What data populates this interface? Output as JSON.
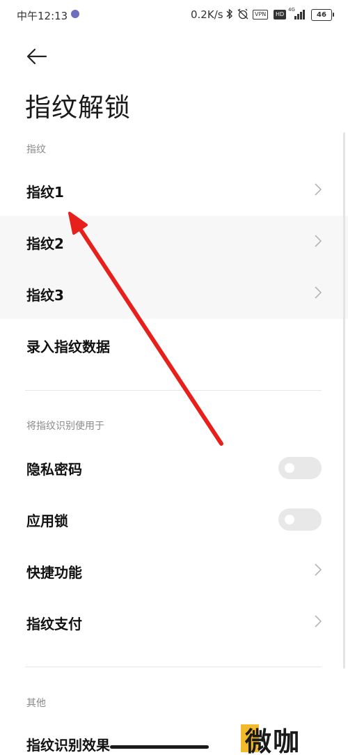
{
  "status_bar": {
    "time": "中午12:13",
    "network_speed": "0.2K/s",
    "vpn_badge": "VPN",
    "hd_badge": "HD",
    "signal_label": "4G",
    "battery_level": "46"
  },
  "header": {
    "title": "指纹解锁"
  },
  "fingerprint_section": {
    "header": "指纹",
    "items": [
      {
        "label": "指纹1"
      },
      {
        "label": "指纹2"
      },
      {
        "label": "指纹3"
      },
      {
        "label": "录入指纹数据"
      }
    ]
  },
  "usage_section": {
    "header": "将指纹识别使用于",
    "items": [
      {
        "label": "隐私密码",
        "toggle": false
      },
      {
        "label": "应用锁",
        "toggle": false
      },
      {
        "label": "快捷功能"
      },
      {
        "label": "指纹支付"
      }
    ]
  },
  "other_section": {
    "header": "其他",
    "partial_item": "指纹识别效果"
  },
  "watermark": {
    "text": "微咖"
  },
  "colors": {
    "annotation_arrow": "#e8201c",
    "toggle_off": "#e8e8e8",
    "watermark_accent": "#f2b92a"
  }
}
